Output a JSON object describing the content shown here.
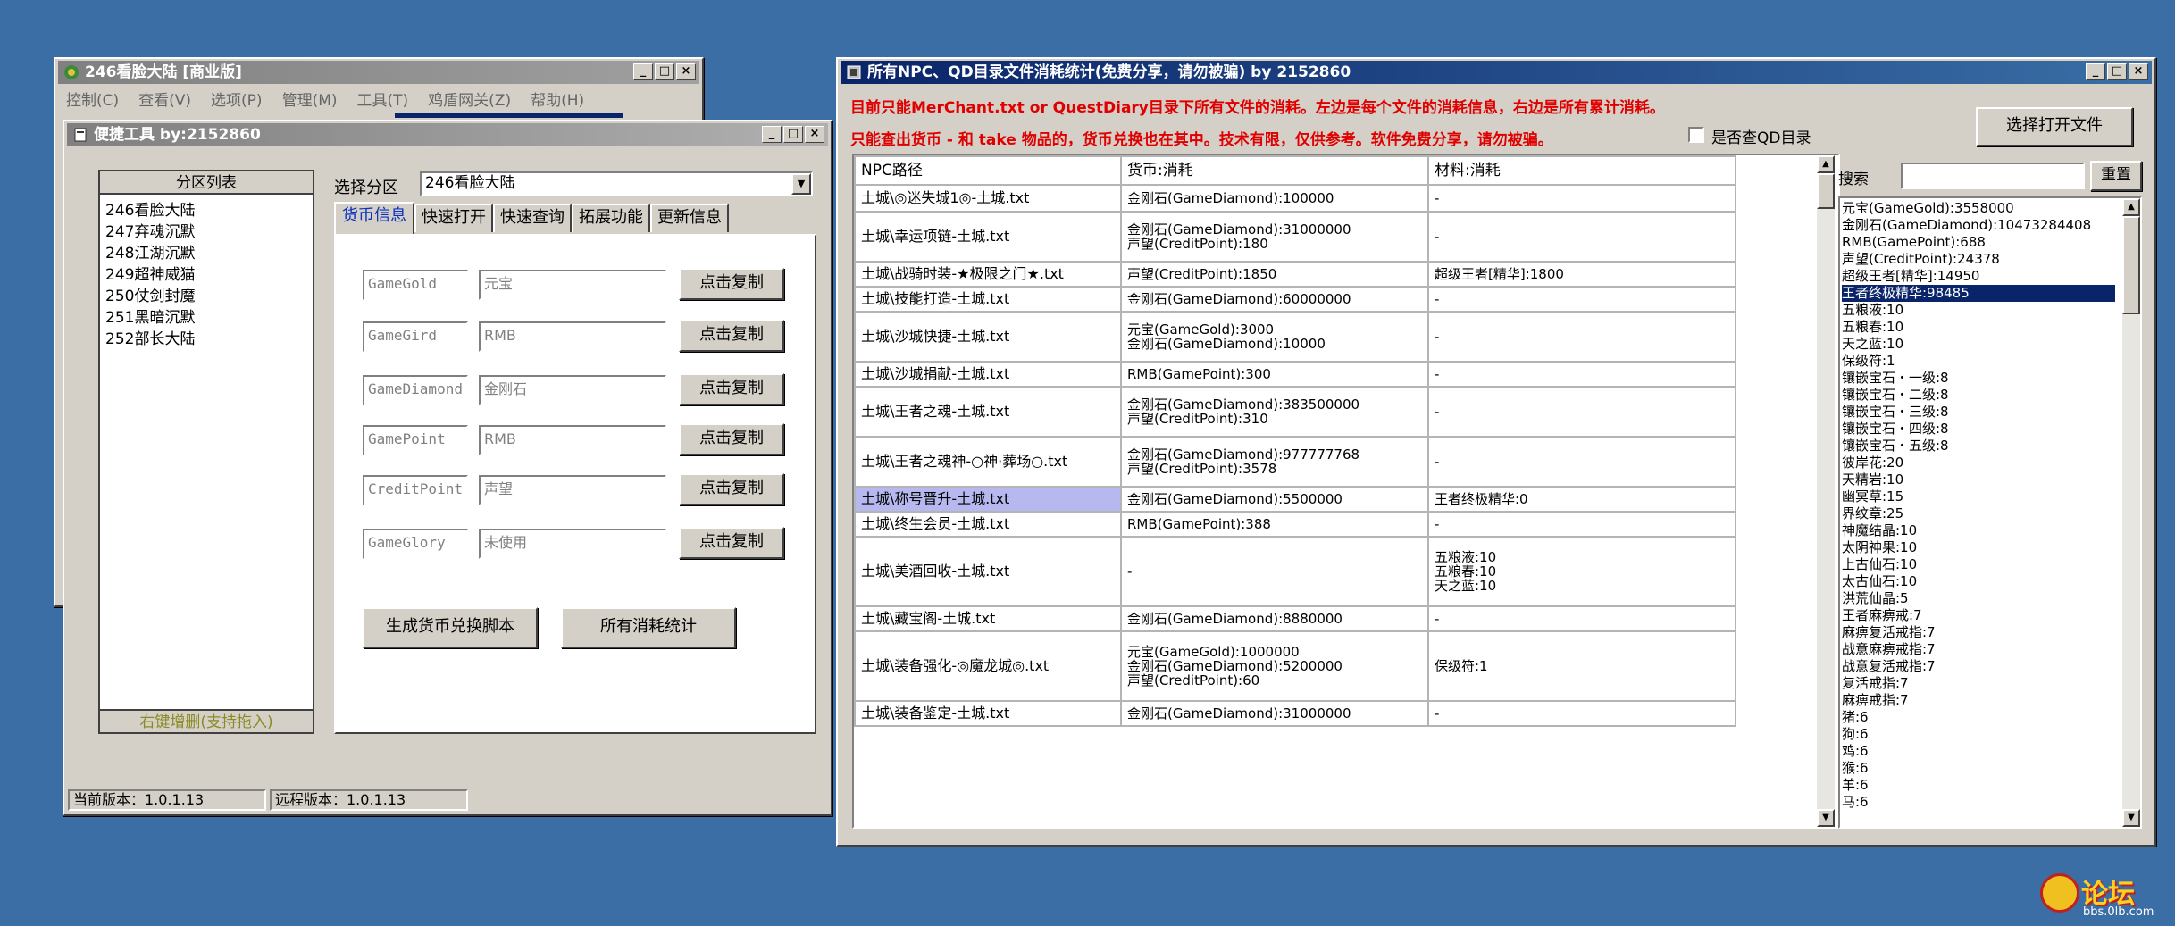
{
  "main_window": {
    "title": "246看脸大陆 [商业版]",
    "menu": [
      "控制(C)",
      "查看(V)",
      "选项(P)",
      "管理(M)",
      "工具(T)",
      "鸡盾网关(Z)",
      "帮助(H)"
    ]
  },
  "tool_window": {
    "title": "便捷工具  by:2152860",
    "zone_list_header": "分区列表",
    "zones": [
      "246看脸大陆",
      "247弃魂沉默",
      "248江湖沉默",
      "249超神威猫",
      "250仗剑封魔",
      "251黑暗沉默",
      "252部长大陆"
    ],
    "zone_hint": "右键增删(支持拖入)",
    "select_label": "选择分区",
    "select_value": "246看脸大陆",
    "tabs": [
      "货币信息",
      "快速打开",
      "快速查询",
      "拓展功能",
      "更新信息"
    ],
    "currency_rows": [
      {
        "code": "GameGold",
        "name": "元宝",
        "button": "点击复制"
      },
      {
        "code": "GameGird",
        "name": "RMB",
        "button": "点击复制"
      },
      {
        "code": "GameDiamond",
        "name": "金刚石",
        "button": "点击复制"
      },
      {
        "code": "GamePoint",
        "name": "RMB",
        "button": "点击复制"
      },
      {
        "code": "CreditPoint",
        "name": "声望",
        "button": "点击复制"
      },
      {
        "code": "GameGlory",
        "name": "未使用",
        "button": "点击复制"
      }
    ],
    "btn_generate": "生成货币兑换脚本",
    "btn_stats": "所有消耗统计",
    "status_local": "当前版本：1.0.1.13",
    "status_remote": "远程版本：1.0.1.13"
  },
  "stats_window": {
    "title": "所有NPC、QD目录文件消耗统计(免费分享，请勿被骗)     by 2152860",
    "notice1": "目前只能MerChant.txt or QuestDiary目录下所有文件的消耗。左边是每个文件的消耗信息，右边是所有累计消耗。",
    "notice2": "只能查出货币 - 和 take 物品的，货币兑换也在其中。技术有限，仅供参考。软件免费分享，请勿被骗。",
    "checkbox_label": "是否查QD目录",
    "open_button": "选择打开文件",
    "search_label": "搜索",
    "search_value": "",
    "reset_button": "重置",
    "columns": [
      "NPC路径",
      "货币:消耗",
      "材料:消耗"
    ],
    "rows": [
      {
        "path": "土城\\◎迷失城1◎-土城.txt",
        "currency": "金刚石(GameDiamond):100000",
        "material": "-"
      },
      {
        "path": "土城\\幸运项链-土城.txt",
        "currency": "金刚石(GameDiamond):31000000\n声望(CreditPoint):180",
        "material": "-"
      },
      {
        "path": "土城\\战骑时装-★极限之门★.txt",
        "currency": "声望(CreditPoint):1850",
        "material": "超级王者[精华]:1800"
      },
      {
        "path": "土城\\技能打造-土城.txt",
        "currency": "金刚石(GameDiamond):60000000",
        "material": "-"
      },
      {
        "path": "土城\\沙城快捷-土城.txt",
        "currency": "元宝(GameGold):3000\n金刚石(GameDiamond):10000",
        "material": "-"
      },
      {
        "path": "土城\\沙城捐献-土城.txt",
        "currency": "RMB(GamePoint):300",
        "material": "-"
      },
      {
        "path": "土城\\王者之魂-土城.txt",
        "currency": "金刚石(GameDiamond):383500000\n声望(CreditPoint):310",
        "material": "-"
      },
      {
        "path": "土城\\王者之魂神-○神·葬场○.txt",
        "currency": "金刚石(GameDiamond):977777768\n声望(CreditPoint):3578",
        "material": "-"
      },
      {
        "path": "土城\\称号晋升-土城.txt",
        "currency": "金刚石(GameDiamond):5500000",
        "material": "王者终极精华:0"
      },
      {
        "path": "土城\\终生会员-土城.txt",
        "currency": "RMB(GamePoint):388",
        "material": "-"
      },
      {
        "path": "土城\\美酒回收-土城.txt",
        "currency": "-",
        "material": "五粮液:10\n五粮春:10\n天之蓝:10"
      },
      {
        "path": "土城\\藏宝阁-土城.txt",
        "currency": "金刚石(GameDiamond):8880000",
        "material": "-"
      },
      {
        "path": "土城\\装备强化-◎魔龙城◎.txt",
        "currency": "元宝(GameGold):1000000\n金刚石(GameDiamond):5200000\n声望(CreditPoint):60",
        "material": "保级符:1"
      },
      {
        "path": "土城\\装备鉴定-土城.txt",
        "currency": "金刚石(GameDiamond):31000000",
        "material": "-"
      }
    ],
    "totals": [
      "元宝(GameGold):3558000",
      "金刚石(GameDiamond):10473284408",
      "RMB(GamePoint):688",
      "声望(CreditPoint):24378",
      "超级王者[精华]:14950",
      "王者终极精华:98485",
      "五粮液:10",
      "五粮春:10",
      "天之蓝:10",
      "保级符:1",
      "镶嵌宝石・一级:8",
      "镶嵌宝石・二级:8",
      "镶嵌宝石・三级:8",
      "镶嵌宝石・四级:8",
      "镶嵌宝石・五级:8",
      "彼岸花:20",
      "天精岩:10",
      "幽冥草:15",
      "界纹章:25",
      "神魔结晶:10",
      "太阴神果:10",
      "上古仙石:10",
      "太古仙石:10",
      "洪荒仙晶:5",
      "王者麻痹戒:7",
      "麻痹复活戒指:7",
      "战意麻痹戒指:7",
      "战意复活戒指:7",
      "复活戒指:7",
      "麻痹戒指:7",
      "猪:6",
      "狗:6",
      "鸡:6",
      "猴:6",
      "羊:6",
      "马:6"
    ],
    "selected_total_index": 5
  },
  "watermark": {
    "brand": "论坛",
    "url": "bbs.0lb.com"
  }
}
